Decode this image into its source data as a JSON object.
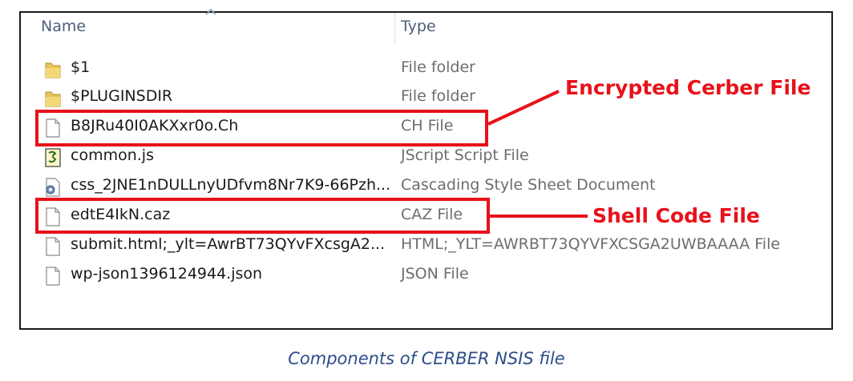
{
  "headers": {
    "name": "Name",
    "type": "Type"
  },
  "files": [
    {
      "name": "$1",
      "type": "File folder",
      "icon": "folder-icon"
    },
    {
      "name": "$PLUGINSDIR",
      "type": "File folder",
      "icon": "folder-icon"
    },
    {
      "name": "B8JRu40I0AKXxr0o.Ch",
      "type": "CH File",
      "icon": "blank-file-icon"
    },
    {
      "name": "common.js",
      "type": "JScript Script File",
      "icon": "script-file-icon"
    },
    {
      "name": "css_2JNE1nDULLnyUDfvm8Nr7K9-66Pzh...",
      "type": "Cascading Style Sheet Document",
      "icon": "stylesheet-file-icon"
    },
    {
      "name": "edtE4IkN.caz",
      "type": "CAZ File",
      "icon": "blank-file-icon"
    },
    {
      "name": "submit.html;_ylt=AwrBT73QYvFXcsgA2...",
      "type": "HTML;_YLT=AWRBT73QYVFXCSGA2UWBAAAA File",
      "icon": "blank-file-icon"
    },
    {
      "name": "wp-json1396124944.json",
      "type": "JSON File",
      "icon": "blank-file-icon"
    }
  ],
  "annotations": {
    "encrypted": "Encrypted Cerber File",
    "shellcode": "Shell Code File"
  },
  "caption": "Components of CERBER NSIS file",
  "colors": {
    "highlight": "#e8111a",
    "caption": "#2e4d8a",
    "type_text": "#6d6d6d"
  }
}
